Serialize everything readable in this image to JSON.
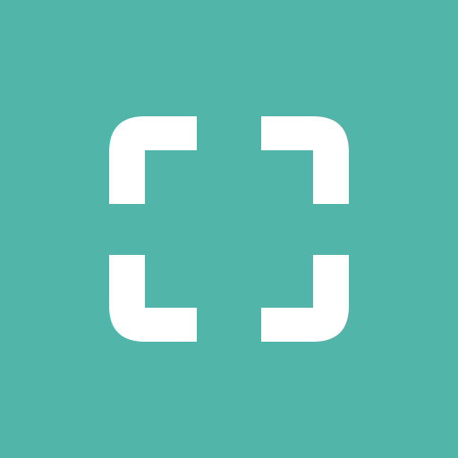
{
  "icon": {
    "name": "scan-frame-icon",
    "background_color": "#52B5AA",
    "foreground_color": "#FFFFFF"
  }
}
